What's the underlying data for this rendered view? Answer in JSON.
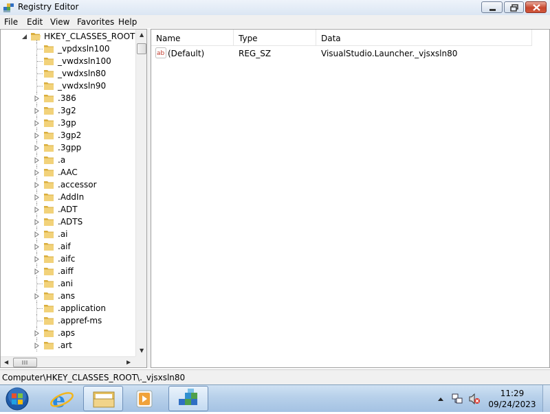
{
  "window": {
    "title": "Registry Editor"
  },
  "menu": [
    "File",
    "Edit",
    "View",
    "Favorites",
    "Help"
  ],
  "tree": {
    "root_label": "HKEY_CLASSES_ROOT",
    "items": [
      "_vpdxsln100",
      "_vwdxsln100",
      "_vwdxsln80",
      "_vwdxsln90",
      ".386",
      ".3g2",
      ".3gp",
      ".3gp2",
      ".3gpp",
      ".a",
      ".AAC",
      ".accessor",
      ".AddIn",
      ".ADT",
      ".ADTS",
      ".ai",
      ".aif",
      ".aifc",
      ".aiff",
      ".ani",
      ".ans",
      ".application",
      ".appref-ms",
      ".aps",
      ".art"
    ],
    "expandable": [
      false,
      false,
      false,
      false,
      true,
      true,
      true,
      true,
      true,
      true,
      true,
      true,
      true,
      true,
      true,
      true,
      true,
      true,
      true,
      false,
      true,
      false,
      false,
      true,
      true
    ]
  },
  "values": {
    "columns": [
      "Name",
      "Type",
      "Data"
    ],
    "rows": [
      {
        "name": "(Default)",
        "type": "REG_SZ",
        "data": "VisualStudio.Launcher._vjsxsln80"
      }
    ]
  },
  "status": {
    "path": "Computer\\HKEY_CLASSES_ROOT\\._vjsxsln80"
  },
  "taskbar": {
    "pinned": [
      "windows-start-orb",
      "internet-explorer-icon",
      "windows-explorer-icon",
      "media-player-icon",
      "registry-editor-icon"
    ],
    "clock_time": "11:29",
    "clock_date": "09/24/2023"
  },
  "colors": {
    "folder": "#e8c460",
    "taskbar": "#b7d0ea",
    "accent": "#3c6fb4"
  }
}
